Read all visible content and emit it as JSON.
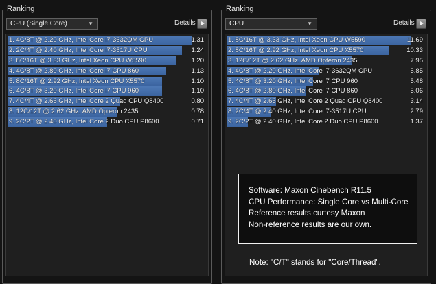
{
  "left_panel": {
    "title": "Ranking",
    "dropdown_value": "CPU (Single Core)",
    "details_label": "Details",
    "max_score": 1.31,
    "rows": [
      {
        "label": "1. 4C/8T @ 2.20 GHz,  Intel Core i7-3632QM CPU",
        "score": "1.31",
        "value": 1.31
      },
      {
        "label": "2. 2C/4T @ 2.40 GHz,  Intel Core i7-3517U CPU",
        "score": "1.24",
        "value": 1.24
      },
      {
        "label": "3. 8C/16T @ 3.33 GHz, Intel Xeon CPU W5590",
        "score": "1.20",
        "value": 1.2
      },
      {
        "label": "4. 4C/8T @ 2.80 GHz, Intel Core i7 CPU 860",
        "score": "1.13",
        "value": 1.13
      },
      {
        "label": "5. 8C/16T @ 2.92 GHz, Intel Xeon CPU X5570",
        "score": "1.10",
        "value": 1.1
      },
      {
        "label": "6. 4C/8T @ 3.20 GHz, Intel Core i7 CPU 960",
        "score": "1.10",
        "value": 1.1
      },
      {
        "label": "7. 4C/4T @ 2.66 GHz, Intel Core 2 Quad CPU Q8400",
        "score": "0.80",
        "value": 0.8
      },
      {
        "label": "8. 12C/12T @ 2.62 GHz, AMD Opteron 2435",
        "score": "0.78",
        "value": 0.78
      },
      {
        "label": "9. 2C/2T @ 2.40 GHz, Intel Core 2 Duo CPU P8600",
        "score": "0.71",
        "value": 0.71
      }
    ]
  },
  "right_panel": {
    "title": "Ranking",
    "dropdown_value": "CPU",
    "details_label": "Details",
    "max_score": 11.69,
    "rows": [
      {
        "label": "1. 8C/16T @ 3.33 GHz, Intel Xeon CPU W5590",
        "score": "11.69",
        "value": 11.69
      },
      {
        "label": "2. 8C/16T @ 2.92 GHz, Intel Xeon CPU X5570",
        "score": "10.33",
        "value": 10.33
      },
      {
        "label": "3. 12C/12T @ 2.62 GHz, AMD Opteron 2435",
        "score": "7.95",
        "value": 7.95
      },
      {
        "label": "4. 4C/8T @ 2.20 GHz,  Intel Core i7-3632QM CPU",
        "score": "5.85",
        "value": 5.85
      },
      {
        "label": "5. 4C/8T @ 3.20 GHz, Intel Core i7 CPU 960",
        "score": "5.48",
        "value": 5.48
      },
      {
        "label": "6. 4C/8T @ 2.80 GHz, Intel Core i7 CPU 860",
        "score": "5.06",
        "value": 5.06
      },
      {
        "label": "7. 4C/4T @ 2.66 GHz, Intel Core 2 Quad CPU Q8400",
        "score": "3.14",
        "value": 3.14
      },
      {
        "label": "8. 2C/4T @ 2.40 GHz,  Intel Core i7-3517U CPU",
        "score": "2.79",
        "value": 2.79
      },
      {
        "label": "9. 2C/2T @ 2.40 GHz, Intel Core 2 Duo CPU P8600",
        "score": "1.37",
        "value": 1.37
      }
    ]
  },
  "info_box": {
    "line1": "Software: Maxon Cinebench R11.5",
    "line2": "CPU Performance: Single Core vs Multi-Core",
    "line3": "Reference results curtesy Maxon",
    "line4": "Non-reference results are our own."
  },
  "footnote": "Note: \"C/T\" stands for \"Core/Thread\".",
  "colors": {
    "bar": "#4470ad",
    "background": "#141414"
  }
}
